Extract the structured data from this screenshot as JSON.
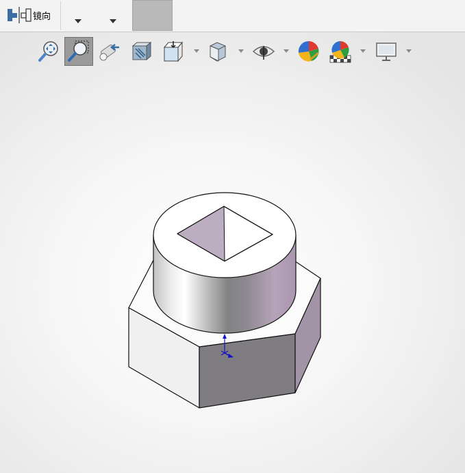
{
  "command_bar": {
    "mirror_label": "镜向"
  },
  "heads_up_toolbar": {
    "buttons": [
      {
        "icon": "zoom-to-fit-icon",
        "active": false
      },
      {
        "icon": "zoom-to-area-icon",
        "active": true
      },
      {
        "icon": "previous-view-icon",
        "active": false
      },
      {
        "icon": "section-view-icon",
        "active": false
      },
      {
        "icon": "view-orientation-icon",
        "active": false,
        "dropdown": true
      },
      {
        "icon": "display-style-icon",
        "active": false,
        "dropdown": true
      },
      {
        "icon": "hide-show-items-icon",
        "active": false,
        "dropdown": true
      },
      {
        "icon": "edit-appearance-icon",
        "active": false
      },
      {
        "icon": "apply-scene-icon",
        "active": false,
        "dropdown": true
      },
      {
        "icon": "view-settings-icon",
        "active": false,
        "dropdown": true
      }
    ]
  },
  "viewport": {
    "model": "hex-nut-with-round-boss-and-square-hole",
    "colors": {
      "face_dark": "#7d7a80",
      "face_side": "#a293a6",
      "face_light": "#f3f3f3",
      "square_hole": "#b9a9bd",
      "triad": "#0000cc"
    }
  }
}
